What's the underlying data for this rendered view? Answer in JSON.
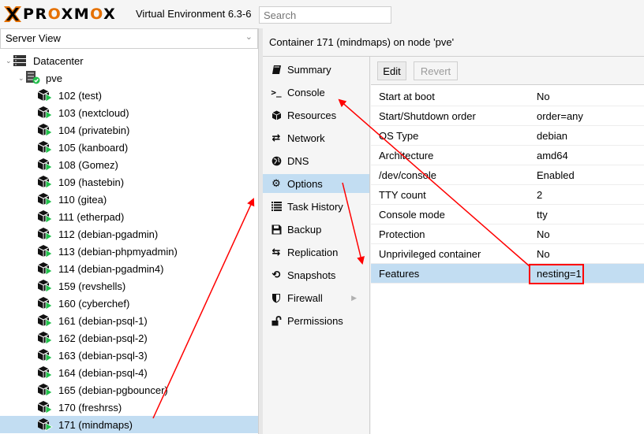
{
  "header": {
    "brand": "PROXMOX",
    "version": "Virtual Environment 6.3-6",
    "search_placeholder": "Search"
  },
  "left_panel": {
    "view_label": "Server View",
    "datacenter": "Datacenter",
    "node": "pve",
    "containers": [
      "102 (test)",
      "103 (nextcloud)",
      "104 (privatebin)",
      "105 (kanboard)",
      "108 (Gomez)",
      "109 (hastebin)",
      "110 (gitea)",
      "111 (etherpad)",
      "112 (debian-pgadmin)",
      "113 (debian-phpmyadmin)",
      "114 (debian-pgadmin4)",
      "159 (revshells)",
      "160 (cyberchef)",
      "161 (debian-psql-1)",
      "162 (debian-psql-2)",
      "163 (debian-psql-3)",
      "164 (debian-psql-4)",
      "165 (debian-pgbouncer)",
      "170 (freshrss)",
      "171 (mindmaps)"
    ],
    "selected": "171 (mindmaps)"
  },
  "content": {
    "title": "Container 171 (mindmaps) on node 'pve'"
  },
  "menu": {
    "items": [
      {
        "label": "Summary",
        "icon": "book-icon"
      },
      {
        "label": "Console",
        "icon": "terminal-icon"
      },
      {
        "label": "Resources",
        "icon": "cube-icon"
      },
      {
        "label": "Network",
        "icon": "exchange-icon"
      },
      {
        "label": "DNS",
        "icon": "globe-icon"
      },
      {
        "label": "Options",
        "icon": "gear-icon"
      },
      {
        "label": "Task History",
        "icon": "list-icon"
      },
      {
        "label": "Backup",
        "icon": "floppy-icon"
      },
      {
        "label": "Replication",
        "icon": "retweet-icon"
      },
      {
        "label": "Snapshots",
        "icon": "history-icon"
      },
      {
        "label": "Firewall",
        "icon": "shield-icon"
      },
      {
        "label": "Permissions",
        "icon": "unlock-icon"
      }
    ],
    "active": "Options"
  },
  "toolbar": {
    "edit_label": "Edit",
    "revert_label": "Revert"
  },
  "options": {
    "rows": [
      {
        "key": "Start at boot",
        "value": "No"
      },
      {
        "key": "Start/Shutdown order",
        "value": "order=any"
      },
      {
        "key": "OS Type",
        "value": "debian"
      },
      {
        "key": "Architecture",
        "value": "amd64"
      },
      {
        "key": "/dev/console",
        "value": "Enabled"
      },
      {
        "key": "TTY count",
        "value": "2"
      },
      {
        "key": "Console mode",
        "value": "tty"
      },
      {
        "key": "Protection",
        "value": "No"
      },
      {
        "key": "Unprivileged container",
        "value": "No"
      },
      {
        "key": "Features",
        "value": "nesting=1"
      }
    ],
    "selected": "Features"
  },
  "colors": {
    "brand_orange": "#e57000",
    "selection": "#c2ddf2",
    "running_green": "#21bf4b",
    "annotation_red": "#ff0000"
  }
}
